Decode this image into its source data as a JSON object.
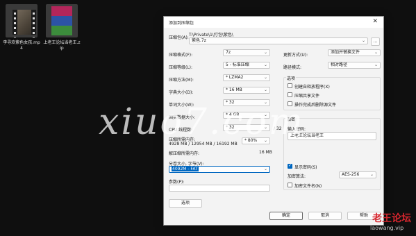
{
  "desktop": {
    "files": [
      {
        "name": "李寻欢紫色女孩.mp4",
        "icon": "video-file-icon"
      },
      {
        "name": "上老王论坛当老王.zip",
        "icon": "winrar-archive-icon"
      }
    ]
  },
  "dialog": {
    "title": "添加到压缩包",
    "close_glyph": "✕",
    "archive": {
      "label": "压缩包(A):",
      "path_hint": "T:\\Private\\1\\打包\\紫色\\",
      "value": "紫色.7z",
      "browse_label": "..."
    },
    "left": {
      "format": {
        "label": "压缩格式(F):",
        "value": "7z"
      },
      "level": {
        "label": "压缩等级(L):",
        "value": "5 - 标准压缩"
      },
      "method": {
        "label": "压缩方法(M):",
        "value": "* LZMA2"
      },
      "dict": {
        "label": "字典大小(D):",
        "value": "* 16 MB"
      },
      "word": {
        "label": "单词大小(W):",
        "value": "* 32"
      },
      "solid": {
        "label": "固实数据大小:",
        "value": "* 4 GB"
      },
      "threads": {
        "label": "CPU 线程数:",
        "value": "* 32",
        "max": "/ 32"
      },
      "memory": {
        "label": "压缩所需内存:",
        "detail": "4928 MB / 12954 MB / 16192 MB",
        "value": "* 80%"
      },
      "decomp": {
        "label": "解压缩所需内存:",
        "value": "16 MB"
      },
      "volume": {
        "label": "分卷大小, 字节(V):",
        "value": "4092M - FAT"
      },
      "params": {
        "label": "参数(P):",
        "value": ""
      },
      "options_btn": "选项"
    },
    "right": {
      "update": {
        "label": "更新方式(U):",
        "value": "添加并替换文件"
      },
      "pathmode": {
        "label": "路径模式:",
        "value": "相对路径"
      },
      "options": {
        "title": "选项",
        "sfx": {
          "label": "创建自释放程序(X)",
          "checked": false
        },
        "shared": {
          "label": "压缩共享文件",
          "checked": false
        },
        "delete": {
          "label": "操作完成后删除源文件",
          "checked": false
        }
      },
      "encrypt": {
        "title": "加密",
        "pwd_label": "输入密码:",
        "pwd_value": "上老王论坛当老王",
        "show_pwd": {
          "label": "显示密码(S)",
          "checked": true
        },
        "method_label": "加密算法:",
        "method_value": "AES-256",
        "encrypt_names": {
          "label": "加密文件名(N)",
          "checked": false
        }
      }
    },
    "buttons": {
      "ok": "确定",
      "cancel": "取消",
      "help": "帮助"
    }
  },
  "watermark": {
    "text": "xiuo7.com",
    "brand": "老王论坛",
    "brand_url": "laowang.vip",
    "brand_color": "#d6262e"
  }
}
